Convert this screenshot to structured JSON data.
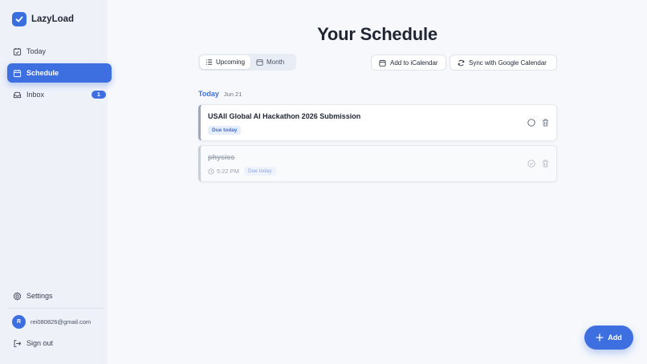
{
  "app": {
    "name": "LazyLoad",
    "logo_icon": "check-icon"
  },
  "sidebar": {
    "items": [
      {
        "label": "Today",
        "icon": "calendar-check-icon",
        "active": false
      },
      {
        "label": "Schedule",
        "icon": "calendar-icon",
        "active": true
      },
      {
        "label": "Inbox",
        "icon": "inbox-icon",
        "active": false,
        "badge": "1"
      }
    ],
    "settings_label": "Settings",
    "user": {
      "initial": "R",
      "email": "rei080826@gmail.com"
    },
    "signout_label": "Sign out"
  },
  "main": {
    "title": "Your Schedule",
    "view_toggle": [
      {
        "label": "Upcoming",
        "icon": "list-icon",
        "active": true
      },
      {
        "label": "Month",
        "icon": "calendar-icon",
        "active": false
      }
    ],
    "actions": {
      "ical_label": "Add to iCalendar",
      "google_label": "Sync with Google Calendar"
    },
    "day": {
      "label": "Today",
      "date": "Jun 21"
    },
    "tasks": [
      {
        "title": "USAII Global AI Hackathon 2026 Submission",
        "due": "Due today",
        "time": "",
        "done": false
      },
      {
        "title": "physics",
        "due": "Due today",
        "time": "5:22 PM",
        "done": true
      }
    ],
    "fab_label": "Add"
  },
  "colors": {
    "accent": "#3d6fe0",
    "sidebar_bg": "#eef1f8",
    "page_bg": "#f6f8fc"
  }
}
